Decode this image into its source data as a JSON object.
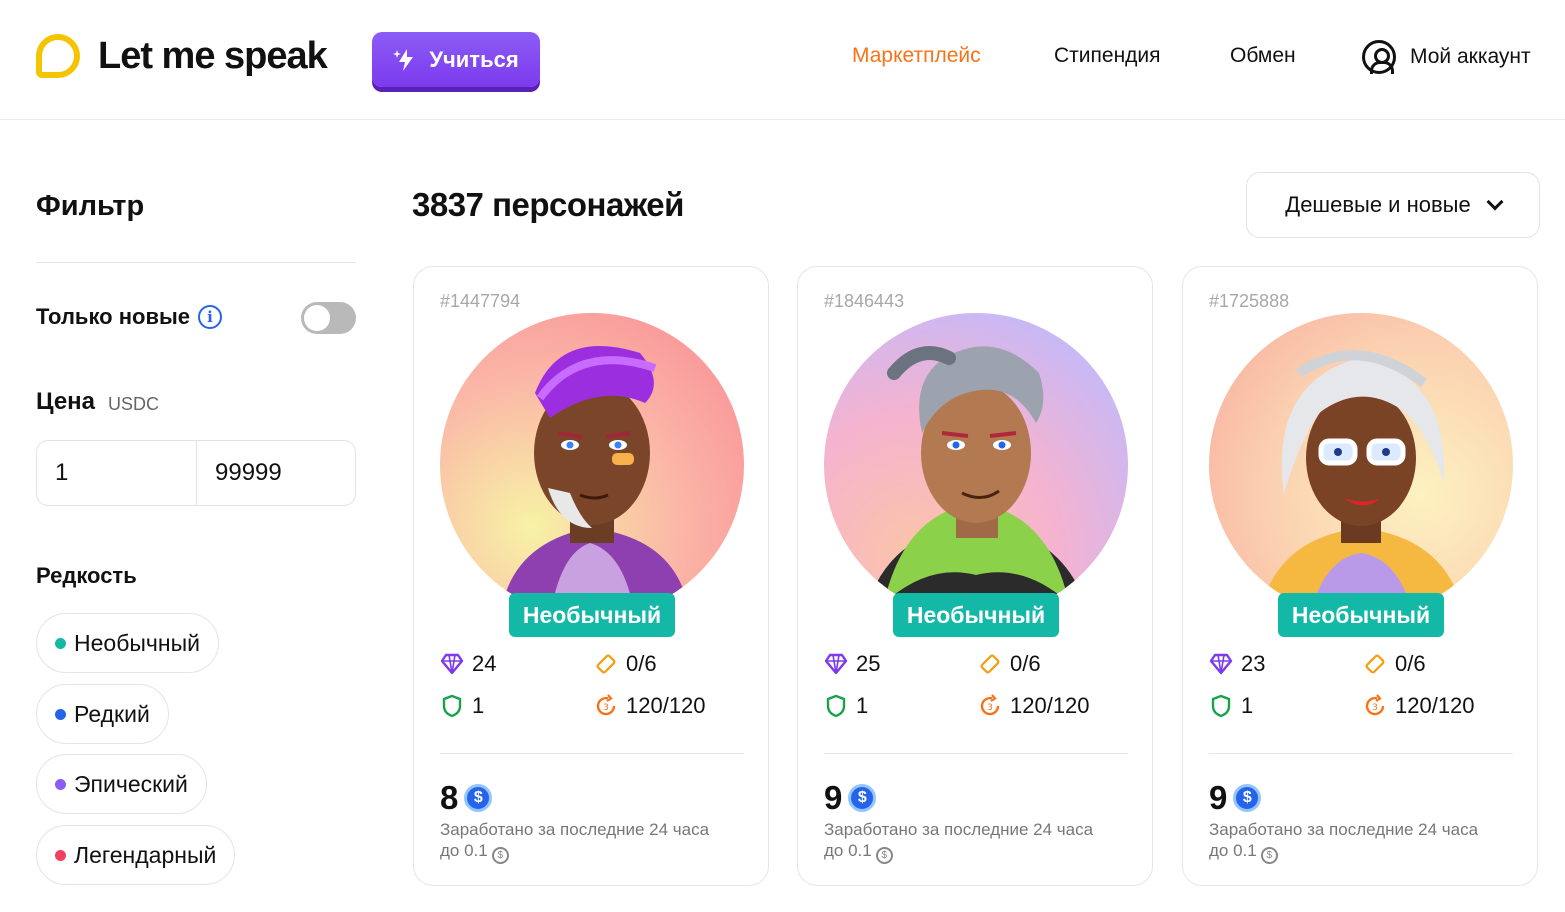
{
  "header": {
    "logo_text": "Let me speak",
    "learn_button": "Учиться",
    "nav": {
      "marketplace": "Маркетплейс",
      "scholarship": "Стипендия",
      "exchange": "Обмен",
      "account": "Мой аккаунт"
    },
    "accent_color": "#f97316",
    "brand_color": "#7c3aed"
  },
  "sidebar": {
    "title": "Фильтр",
    "only_new_label": "Только новые",
    "only_new_enabled": false,
    "price_label": "Цена",
    "price_unit": "USDC",
    "price_min": "1",
    "price_max": "99999",
    "rarity_label": "Редкость",
    "rarities": [
      {
        "label": "Необычный",
        "color": "#14b8a6"
      },
      {
        "label": "Редкий",
        "color": "#2563eb"
      },
      {
        "label": "Эпический",
        "color": "#8b5cf6"
      },
      {
        "label": "Легендарный",
        "color": "#f43f5e"
      }
    ]
  },
  "main": {
    "count_title": "3837 персонажей",
    "sort_label": "Дешевые и новые",
    "cards": [
      {
        "id": "#1447794",
        "rarity": "Необычный",
        "gems": "24",
        "tickets": "0/6",
        "shields": "1",
        "energy": "120/120",
        "price": "8",
        "earned_line1": "Заработано за последние 24 часа",
        "earned_line2": "до 0.1"
      },
      {
        "id": "#1846443",
        "rarity": "Необычный",
        "gems": "25",
        "tickets": "0/6",
        "shields": "1",
        "energy": "120/120",
        "price": "9",
        "earned_line1": "Заработано за последние 24 часа",
        "earned_line2": "до 0.1"
      },
      {
        "id": "#1725888",
        "rarity": "Необычный",
        "gems": "23",
        "tickets": "0/6",
        "shields": "1",
        "energy": "120/120",
        "price": "9",
        "earned_line1": "Заработано за последние 24 часа",
        "earned_line2": "до 0.1"
      }
    ]
  }
}
